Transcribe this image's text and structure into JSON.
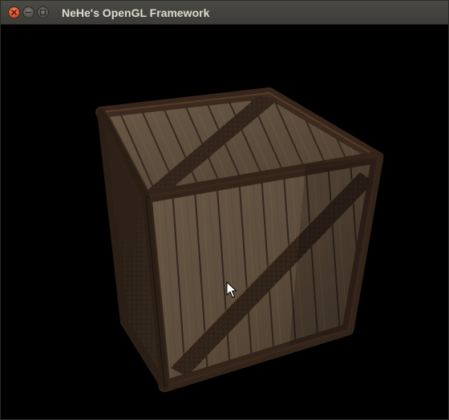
{
  "window": {
    "title": "NeHe's OpenGL Framework"
  },
  "controls": {
    "close_icon": "close-icon",
    "minimize_icon": "minimize-icon",
    "maximize_icon": "maximize-icon"
  },
  "scene": {
    "object": "wooden crate",
    "background_color": "#000000",
    "wood_color": "#5c4c3c",
    "metal_band_color": "#3a2a20"
  }
}
